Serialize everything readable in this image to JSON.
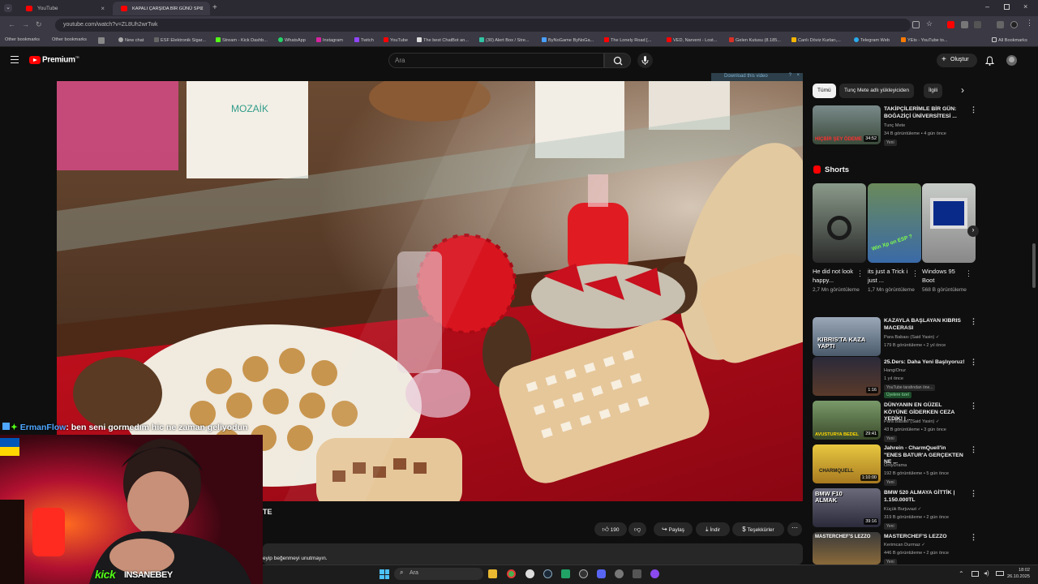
{
  "browser": {
    "tabs": [
      {
        "label": "YouTube",
        "active": false
      },
      {
        "label": "KAPALI ÇARŞIDA BİR GÜNÜ SPC",
        "active": true
      }
    ],
    "url": "youtube.com/watch?v=ZL8Uh2wrTwk",
    "bookmarks": [
      "Other bookmarks",
      "Other bookmarks",
      "New chat",
      "ESF Elektronik Sigar...",
      "Stream - Kick Dashb...",
      "WhatsApp",
      "Instagram",
      "Twitch",
      "YouTube",
      "The best ChatBot an...",
      "(30) Alert Box / Stre...",
      "ByNoGame ByNoGa...",
      "The Lonely Road [...",
      "VED, Narvent - Lost...",
      "Gelen Kutusu (8.185...",
      "Canlı Döviz Kurları,...",
      "Telegram Web",
      "YEts - YouTube to...",
      "All Bookmarks"
    ]
  },
  "header": {
    "logo_text": "Premium",
    "logo_sup": "TR",
    "search_placeholder": "Ara",
    "create_label": "Oluştur"
  },
  "video": {
    "download_label": "Download this video",
    "title_fragment": "TE",
    "description_fragment": "eyip beğenmeyi unutmayın."
  },
  "actions": {
    "likes": "190",
    "share": "Paylaş",
    "download": "İndir",
    "thanks": "Teşekkürler"
  },
  "chips": [
    "Tümü",
    "Tunç Mete adlı yükleyiciden",
    "İlgili"
  ],
  "top_video": {
    "title": "TAKİPÇİLERİMLE BİR GÜN: BOĞAZİÇİ ÜNİVERSİTESİ ...",
    "channel": "Tunç Mete",
    "meta": "34 B görüntüleme • 4 gün önce",
    "badge": "Yeni",
    "duration": "34:52",
    "thumb_text": "HİÇBİR ŞEY ÖDEME"
  },
  "shorts": {
    "heading": "Shorts",
    "items": [
      {
        "title": "He did not look happy...",
        "views": "2,7 Mn görüntüleme"
      },
      {
        "title": "its just a Trick i just ...",
        "views": "1,7 Mn görüntüleme",
        "thumb_text": "Win Xp on ESP ?"
      },
      {
        "title": "Windows 95 Boot",
        "views": "568 B görüntüleme"
      }
    ]
  },
  "related": [
    {
      "title": "KAZAYLA BAŞLAYAN KIBRIS MACERASI",
      "channel": "Para Babası (Said Yasin)",
      "meta": "179 B görüntüleme • 2 yıl önce",
      "badge": "",
      "duration": "",
      "thumb_text": "KIBRIS'TA KAZA YAPTI"
    },
    {
      "title": "25.Ders: Daha Yeni Başlıyoruz!",
      "channel": "HangiOnur",
      "meta": "1 yıl önce",
      "badge": "YouTube tarafından öne...",
      "badge2": "Üyelere özel",
      "duration": "1:16",
      "thumb_text": ""
    },
    {
      "title": "DÜNYANIN EN GÜZEL KÖYÜNE GİDERKEN CEZA YEDİK! | ...",
      "channel": "Para Babası (Said Yasin)",
      "meta": "43 B görüntüleme • 3 gün önce",
      "badge": "Yeni",
      "duration": "29:41",
      "thumb_text": "AVUSTURYA BEDEL"
    },
    {
      "title": "Jahrein - CharmQuell'in \"ENES BATUR'A GERÇEKTEN NE ...",
      "channel": "OnlyDrama",
      "meta": "192 B görüntüleme • 5 gün önce",
      "badge": "Yeni",
      "duration": "1:10:00",
      "thumb_text": "CHARMQUELL"
    },
    {
      "title": "BMW 520 ALMAYA GİTTİK | 1.150.000TL",
      "channel": "Küçük Burjuvazi",
      "meta": "319 B görüntüleme • 2 gün önce",
      "badge": "Yeni",
      "duration": "39:16",
      "thumb_text": "BMW F10 ALMAK"
    },
    {
      "title": "MASTERCHEF'S LEZZO",
      "channel": "Kerimcan Durmaz",
      "meta": "446 B görüntüleme • 2 gün önce",
      "badge": "Yeni",
      "duration": "",
      "thumb_text": "MASTERCHEF'S LEZZO"
    }
  ],
  "overlay": {
    "chat_user": "ErmanFlow",
    "chat_message": ": ben seni gormedım hic ne zaman geliyodun",
    "kick_logo": "kick",
    "kick_name": "INSANEBEY"
  },
  "taskbar": {
    "search_placeholder": "Ara",
    "time": "18:02",
    "date": "26.10.2025"
  },
  "colors": {
    "yt_red": "#ff0000",
    "kick_green": "#53fc18",
    "chat_user": "#4ea6ff"
  }
}
